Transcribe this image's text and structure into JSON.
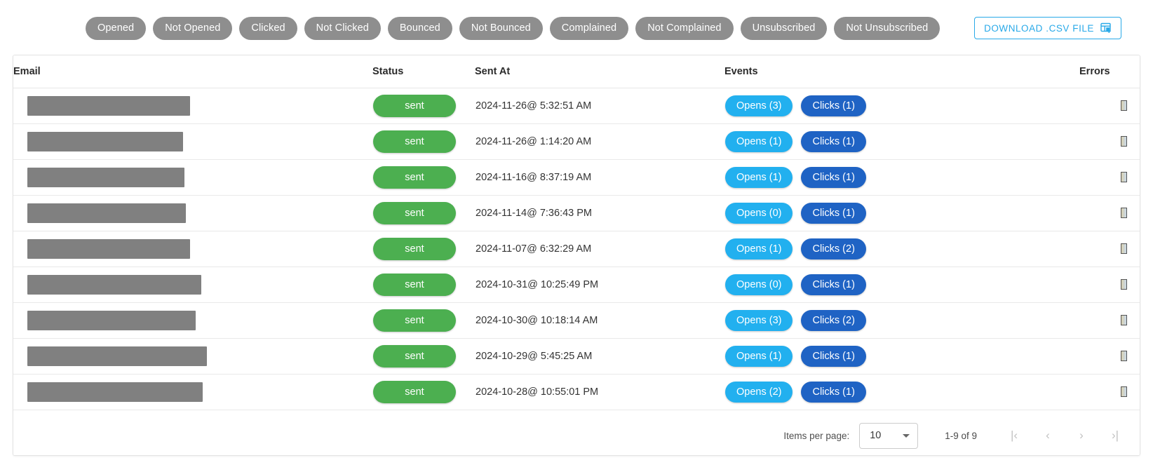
{
  "toolbar": {
    "filters": [
      {
        "label": "Opened"
      },
      {
        "label": "Not Opened"
      },
      {
        "label": "Clicked"
      },
      {
        "label": "Not Clicked"
      },
      {
        "label": "Bounced"
      },
      {
        "label": "Not Bounced"
      },
      {
        "label": "Complained"
      },
      {
        "label": "Not Complained"
      },
      {
        "label": "Unsubscribed"
      },
      {
        "label": "Not Unsubscribed"
      }
    ],
    "download_label": "DOWNLOAD .CSV FILE",
    "download_icon": "table-add-icon",
    "chip_color": "#8e8e8e",
    "download_color": "#29a9e8"
  },
  "table": {
    "columns": [
      "Email",
      "Status",
      "Sent At",
      "Events",
      "Errors"
    ],
    "rows": [
      {
        "email": "",
        "email_redacted_width": 232,
        "status": "sent",
        "sent_at": "2024-11-26@ 5:32:51 AM",
        "opens": "Opens (3)",
        "clicks": "Clicks (1)",
        "errors": ""
      },
      {
        "email": "",
        "email_redacted_width": 222,
        "status": "sent",
        "sent_at": "2024-11-26@ 1:14:20 AM",
        "opens": "Opens (1)",
        "clicks": "Clicks (1)",
        "errors": ""
      },
      {
        "email": "",
        "email_redacted_width": 224,
        "status": "sent",
        "sent_at": "2024-11-16@ 8:37:19 AM",
        "opens": "Opens (1)",
        "clicks": "Clicks (1)",
        "errors": ""
      },
      {
        "email": "",
        "email_redacted_width": 226,
        "status": "sent",
        "sent_at": "2024-11-14@ 7:36:43 PM",
        "opens": "Opens (0)",
        "clicks": "Clicks (1)",
        "errors": ""
      },
      {
        "email": "",
        "email_redacted_width": 232,
        "status": "sent",
        "sent_at": "2024-11-07@ 6:32:29 AM",
        "opens": "Opens (1)",
        "clicks": "Clicks (2)",
        "errors": ""
      },
      {
        "email": "",
        "email_redacted_width": 248,
        "status": "sent",
        "sent_at": "2024-10-31@ 10:25:49 PM",
        "opens": "Opens (0)",
        "clicks": "Clicks (1)",
        "errors": ""
      },
      {
        "email": "",
        "email_redacted_width": 240,
        "status": "sent",
        "sent_at": "2024-10-30@ 10:18:14 AM",
        "opens": "Opens (3)",
        "clicks": "Clicks (2)",
        "errors": ""
      },
      {
        "email": "",
        "email_redacted_width": 256,
        "status": "sent",
        "sent_at": "2024-10-29@ 5:45:25 AM",
        "opens": "Opens (1)",
        "clicks": "Clicks (1)",
        "errors": ""
      },
      {
        "email": "",
        "email_redacted_width": 250,
        "status": "sent",
        "sent_at": "2024-10-28@ 10:55:01 PM",
        "opens": "Opens (2)",
        "clicks": "Clicks (1)",
        "errors": ""
      }
    ],
    "status_color": "#4caf50",
    "opens_color": "#22b0ef",
    "clicks_color": "#1f63c4"
  },
  "paginator": {
    "items_per_page_label": "Items per page:",
    "items_per_page_value": "10",
    "range_label": "1-9 of 9",
    "first_page_icon": "first-page-icon",
    "prev_page_icon": "previous-page-icon",
    "next_page_icon": "next-page-icon",
    "last_page_icon": "last-page-icon",
    "first_page_glyph": "|‹",
    "prev_page_glyph": "‹",
    "next_page_glyph": "›",
    "last_page_glyph": "›|"
  }
}
